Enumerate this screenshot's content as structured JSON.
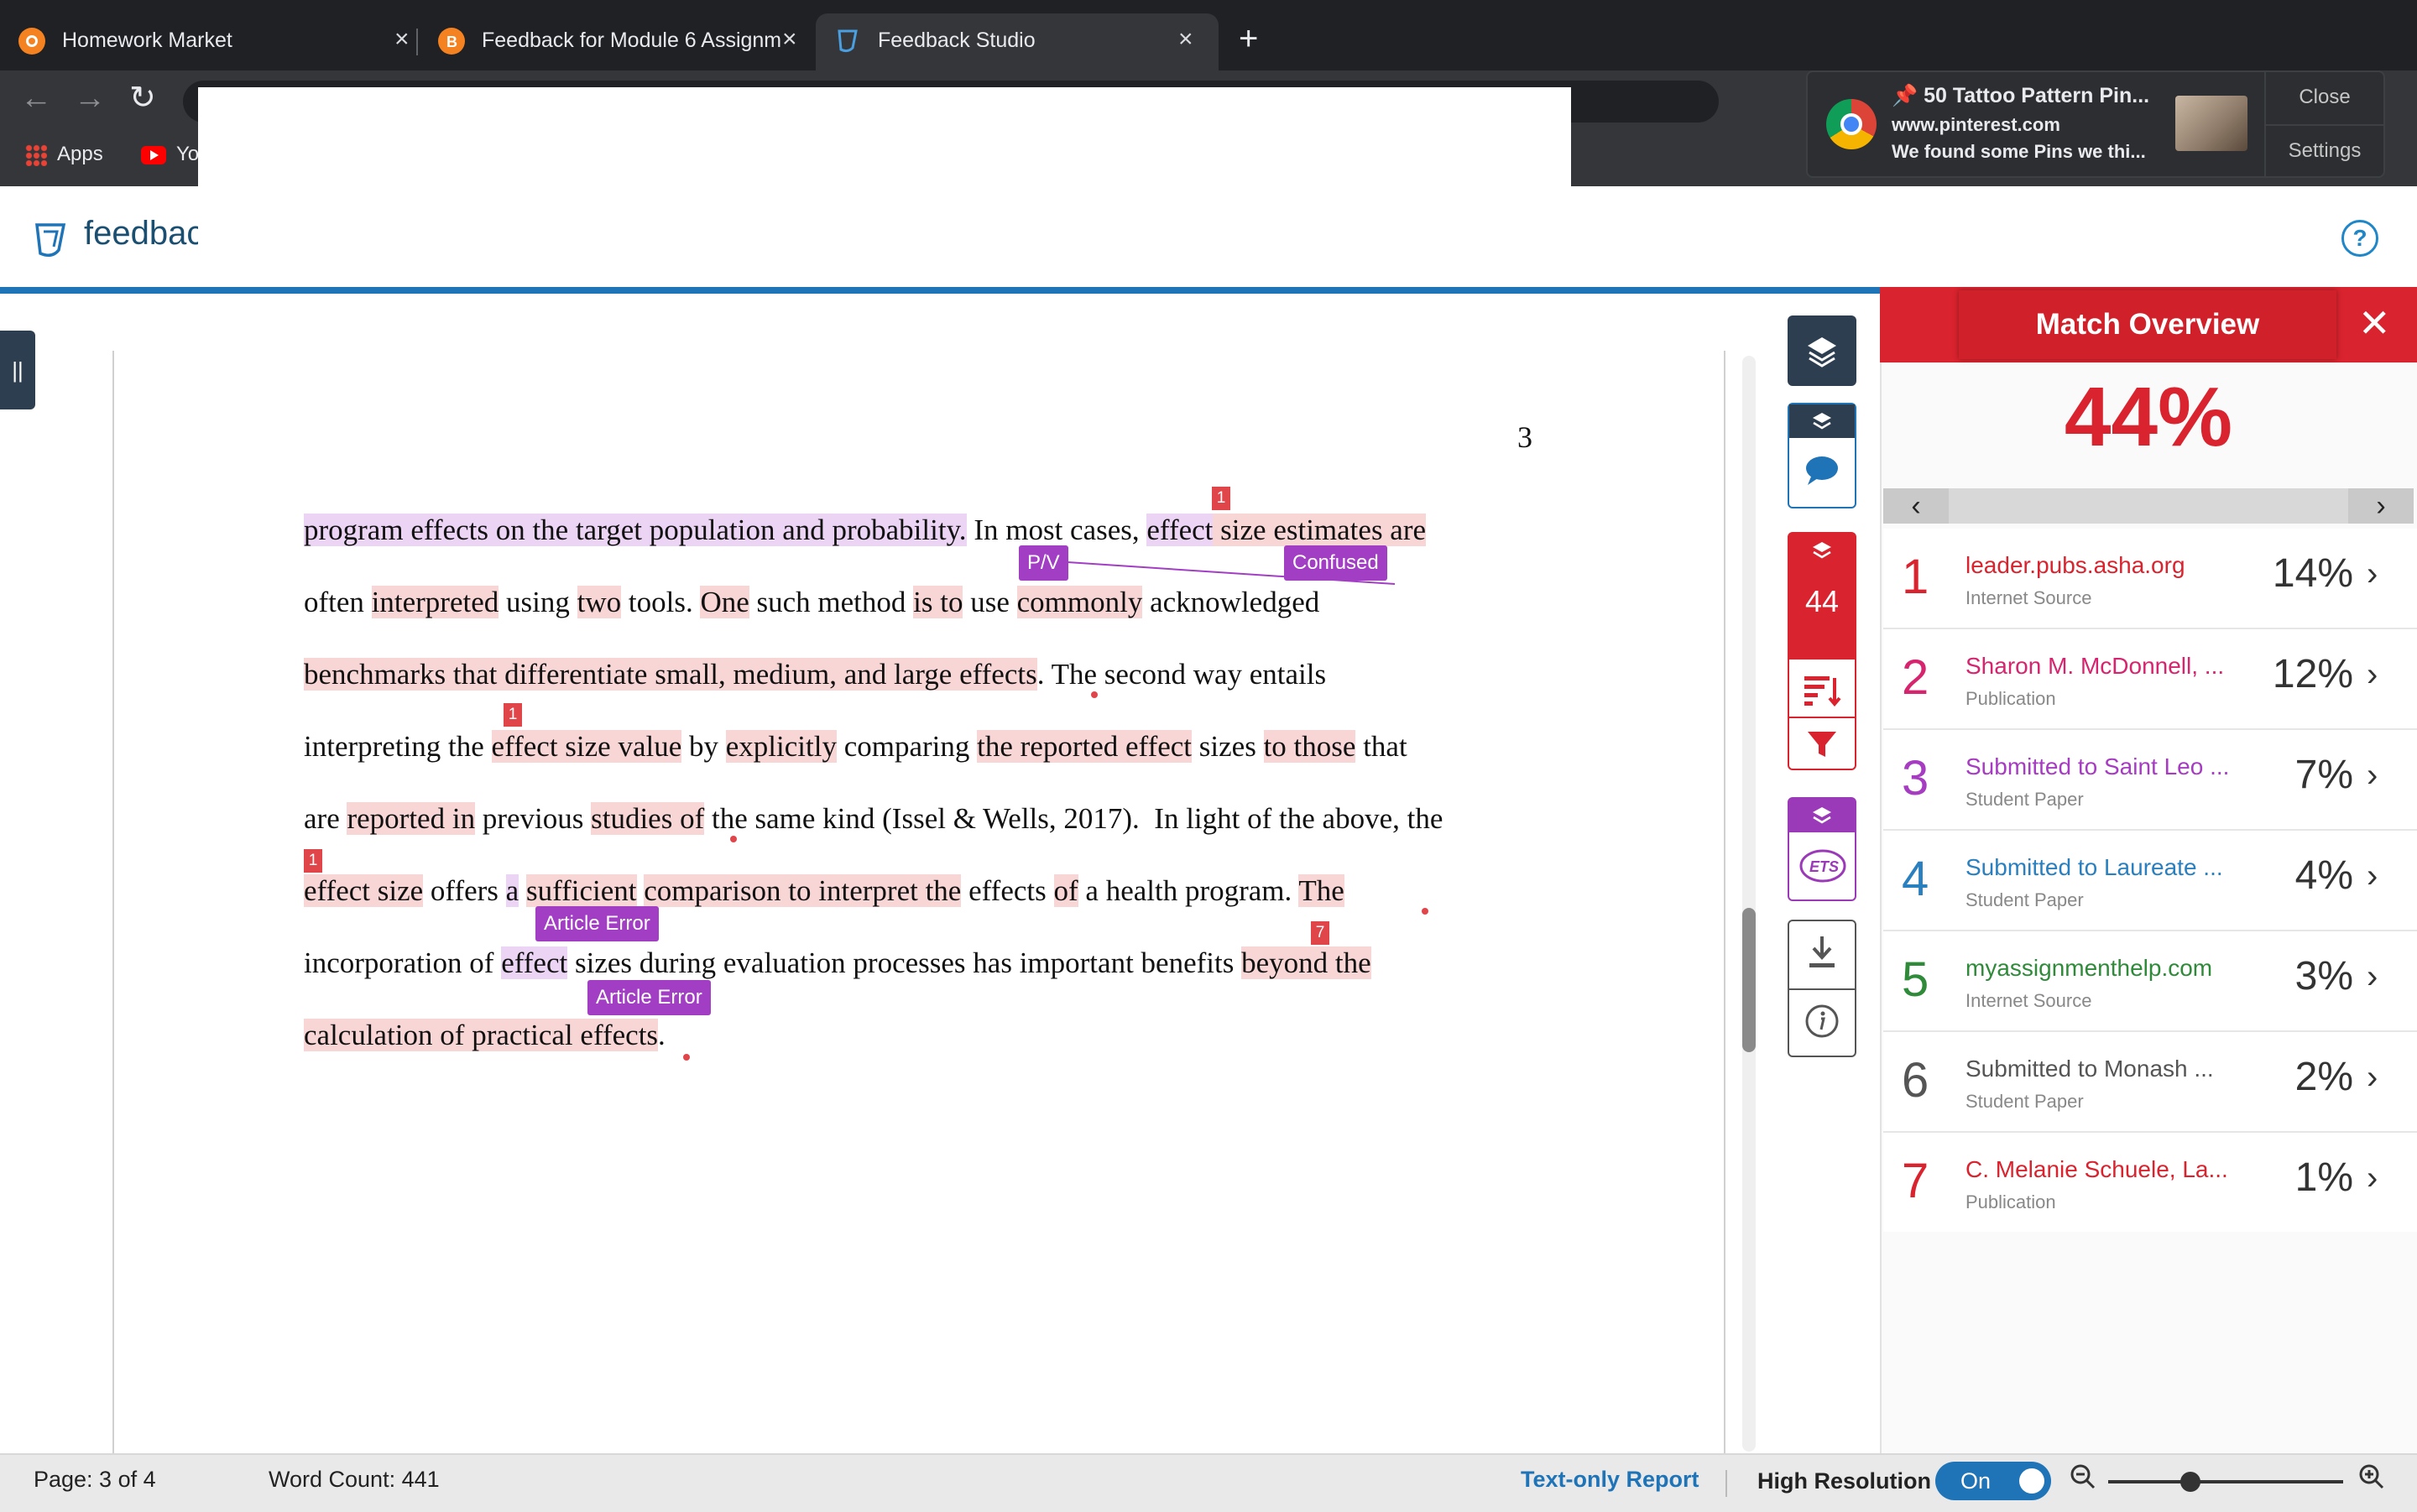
{
  "browser": {
    "tabs": [
      {
        "title": "Homework Market",
        "active": false,
        "favicon_color": "#f58220"
      },
      {
        "title": "Feedback for Module 6 Assignm",
        "active": false,
        "favicon_color": "#f58220"
      },
      {
        "title": "Feedback Studio",
        "active": true,
        "favicon_color": "#1f74b8"
      }
    ],
    "new_tab": "+",
    "bookmarks": [
      {
        "label": "Apps"
      },
      {
        "label": "Yo"
      }
    ]
  },
  "notification": {
    "title": "📌 50 Tattoo Pattern Pin...",
    "site": "www.pinterest.com",
    "message": "We found some Pins we thi...",
    "close_label": "Close",
    "settings_label": "Settings"
  },
  "app": {
    "brand": "feedback",
    "help": "?"
  },
  "document": {
    "page_number": "3",
    "lines": [
      "program effects on the target population and probability. In most cases, effect size estimates are",
      "often interpreted using two tools. One such method is to use commonly acknowledged",
      "benchmarks that differentiate small, medium, and large effects. The second way entails",
      "interpreting the effect size value by explicitly comparing the reported effect sizes to those that",
      "are reported in previous studies of the same kind (Issel & Wells, 2017).  In light of the above, the",
      "effect size offers a sufficient comparison to interpret the effects of a health program. The",
      "incorporation of effect sizes during evaluation processes has important benefits beyond the",
      "calculation of practical effects."
    ],
    "marks": [
      "1",
      "1",
      "1",
      "7"
    ],
    "error_tags": [
      "P/V",
      "Confused",
      "Article Error",
      "Article Error"
    ]
  },
  "tools": {
    "similarity_score": "44"
  },
  "match_panel": {
    "title": "Match Overview",
    "overall": "44%",
    "matches": [
      {
        "rank": "1",
        "source": "leader.pubs.asha.org",
        "type": "Internet Source",
        "percent": "14%",
        "color": "#d9232e"
      },
      {
        "rank": "2",
        "source": "Sharon M. McDonnell, ...",
        "type": "Publication",
        "percent": "12%",
        "color": "#d6246e"
      },
      {
        "rank": "3",
        "source": "Submitted to Saint Leo ...",
        "type": "Student Paper",
        "percent": "7%",
        "color": "#a63cc1"
      },
      {
        "rank": "4",
        "source": "Submitted to Laureate ...",
        "type": "Student Paper",
        "percent": "4%",
        "color": "#2a7fbf"
      },
      {
        "rank": "5",
        "source": "myassignmenthelp.com",
        "type": "Internet Source",
        "percent": "3%",
        "color": "#2f8a3a"
      },
      {
        "rank": "6",
        "source": "Submitted to Monash ...",
        "type": "Student Paper",
        "percent": "2%",
        "color": "#555555"
      },
      {
        "rank": "7",
        "source": "C. Melanie Schuele, La...",
        "type": "Publication",
        "percent": "1%",
        "color": "#d9232e"
      }
    ]
  },
  "status": {
    "page": "Page: 3 of 4",
    "word_count": "Word Count: 441",
    "text_only": "Text-only Report",
    "high_res_label": "High Resolution",
    "high_res_state": "On"
  }
}
